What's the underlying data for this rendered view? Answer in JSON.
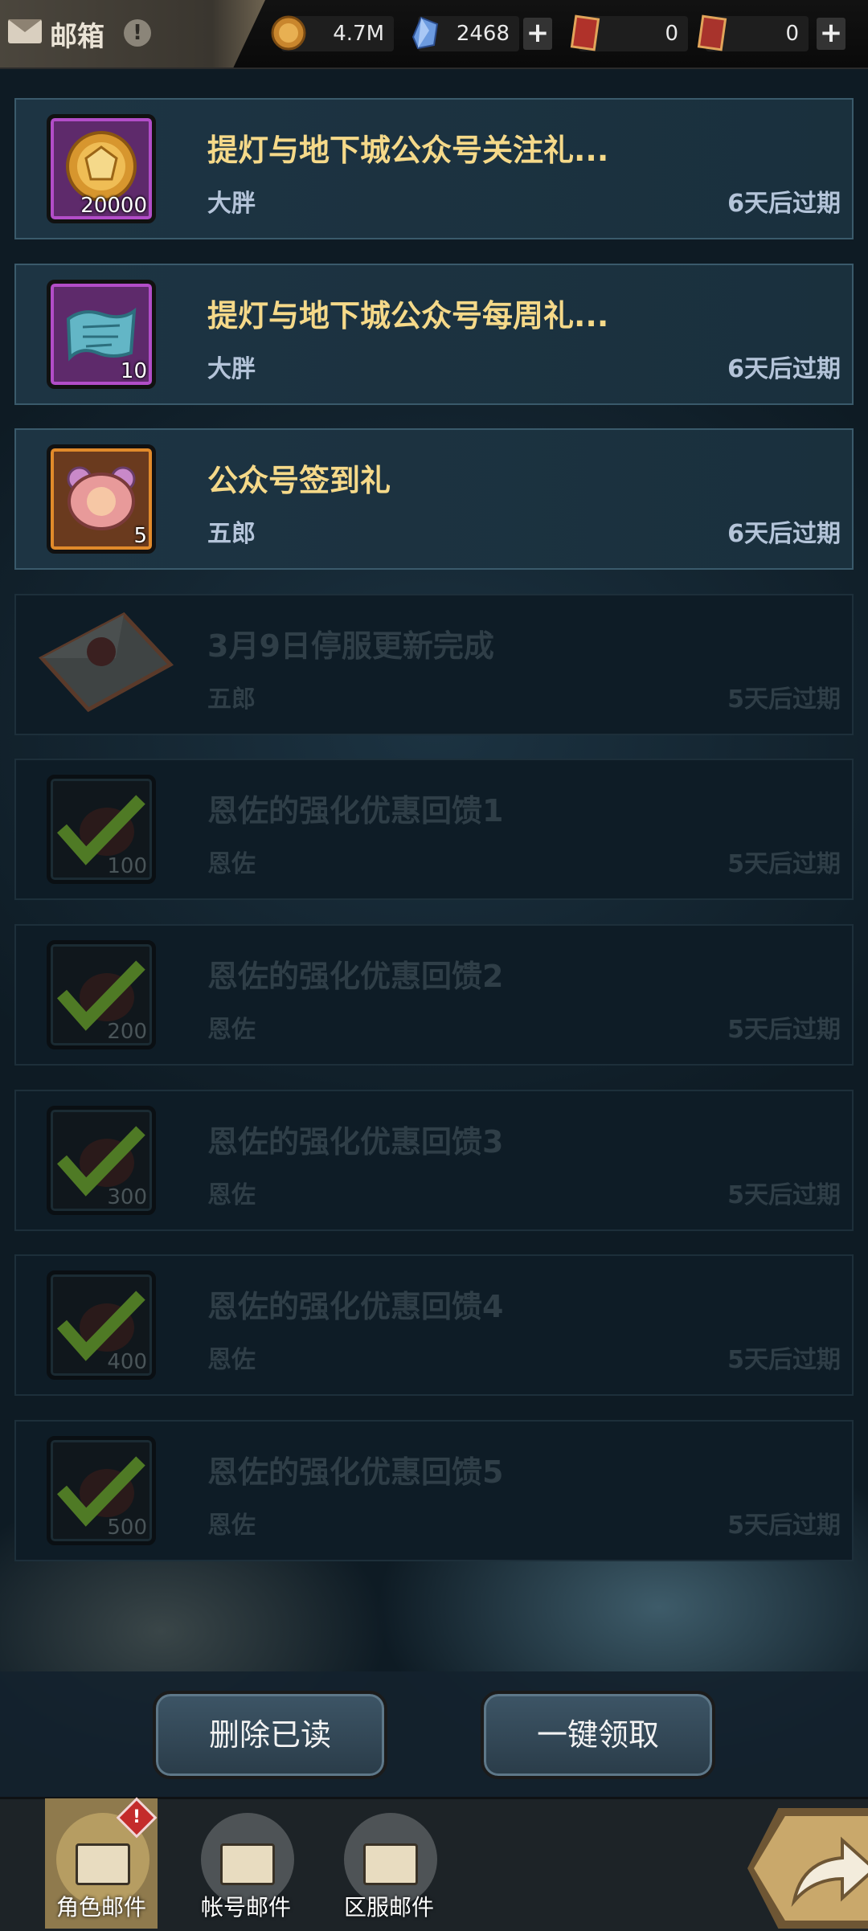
{
  "header": {
    "title": "邮箱",
    "alert_glyph": "!",
    "resources": [
      {
        "name": "gold",
        "icon": "gold-coin-icon",
        "value": "4.7M"
      },
      {
        "name": "crystal",
        "icon": "blue-crystal-icon",
        "value": "2468"
      },
      {
        "name": "ticket_a",
        "icon": "red-ticket-icon",
        "value": "0"
      },
      {
        "name": "ticket_b",
        "icon": "red-card-icon",
        "value": "0"
      }
    ],
    "plus_glyph": "+"
  },
  "mails": [
    {
      "subject": "提灯与地下城公众号关注礼...",
      "sender": "大胖",
      "expire": "6天后过期",
      "qty": "20000",
      "icon": "gold-coin-icon",
      "frame": "purple",
      "read": false
    },
    {
      "subject": "提灯与地下城公众号每周礼...",
      "sender": "大胖",
      "expire": "6天后过期",
      "qty": "10",
      "icon": "blue-scroll-icon",
      "frame": "purple",
      "read": false
    },
    {
      "subject": "公众号签到礼",
      "sender": "五郎",
      "expire": "6天后过期",
      "qty": "5",
      "icon": "pink-pet-food-icon",
      "frame": "orange",
      "read": false
    },
    {
      "subject": "3月9日停服更新完成",
      "sender": "五郎",
      "expire": "5天后过期",
      "qty": "",
      "icon": "sealed-letter-icon",
      "frame": "none",
      "read": true
    },
    {
      "subject": "恩佐的强化优惠回馈1",
      "sender": "恩佐",
      "expire": "5天后过期",
      "qty": "100",
      "icon": "claimed-check-icon",
      "frame": "dark",
      "read": true
    },
    {
      "subject": "恩佐的强化优惠回馈2",
      "sender": "恩佐",
      "expire": "5天后过期",
      "qty": "200",
      "icon": "claimed-check-icon",
      "frame": "dark",
      "read": true
    },
    {
      "subject": "恩佐的强化优惠回馈3",
      "sender": "恩佐",
      "expire": "5天后过期",
      "qty": "300",
      "icon": "claimed-check-icon",
      "frame": "dark",
      "read": true
    },
    {
      "subject": "恩佐的强化优惠回馈4",
      "sender": "恩佐",
      "expire": "5天后过期",
      "qty": "400",
      "icon": "claimed-check-icon",
      "frame": "dark",
      "read": true
    },
    {
      "subject": "恩佐的强化优惠回馈5",
      "sender": "恩佐",
      "expire": "5天后过期",
      "qty": "500",
      "icon": "claimed-check-icon",
      "frame": "dark",
      "read": true
    }
  ],
  "actions": {
    "delete_read": "删除已读",
    "claim_all": "一键领取"
  },
  "tabs": [
    {
      "label": "角色邮件",
      "icon": "letter-icon",
      "active": true
    },
    {
      "label": "帐号邮件",
      "icon": "letter-person-icon",
      "active": false
    },
    {
      "label": "区服邮件",
      "icon": "letter-castle-icon",
      "active": false
    }
  ],
  "tab_alert": "!",
  "share_icon": "share-arrow-icon"
}
